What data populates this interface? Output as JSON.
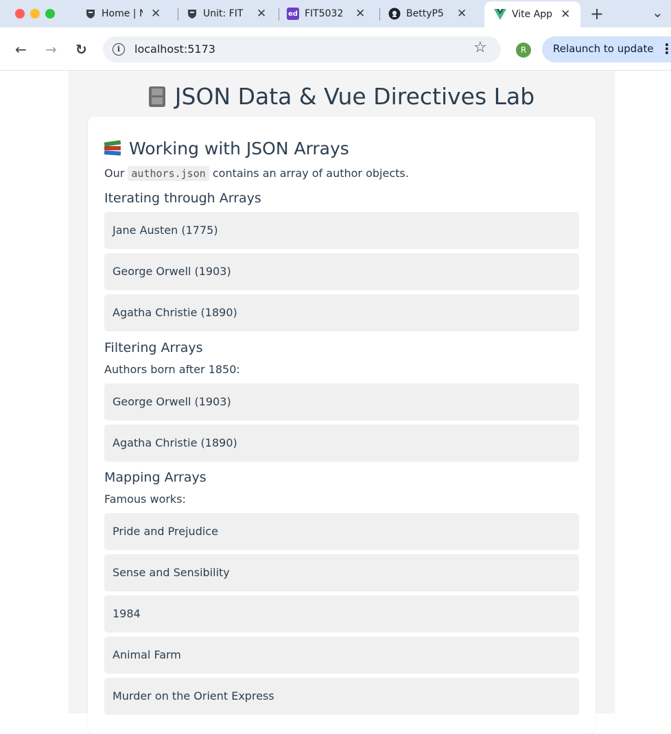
{
  "browser": {
    "tabs": [
      {
        "label": "Home | N",
        "icon": "university-crest-icon"
      },
      {
        "label": "Unit: FIT",
        "icon": "university-crest-icon"
      },
      {
        "label": "FIT5032",
        "icon": "ed-icon",
        "icon_text": "ed"
      },
      {
        "label": "BettyP5",
        "icon": "github-icon"
      },
      {
        "label": "Vite App",
        "icon": "vue-icon",
        "active": true
      }
    ],
    "new_tab": "+",
    "tab_menu": "⌄",
    "url": "localhost:5173",
    "profile_initial": "R",
    "relaunch_label": "Relaunch to update",
    "colors": {
      "accent": "#d3e3fd",
      "tabbar": "#dce5f4",
      "profile": "#5f9f4c",
      "vue_green": "#41b883"
    }
  },
  "page": {
    "title": "JSON Data & Vue Directives Lab",
    "section": {
      "heading": "Working with JSON Arrays",
      "intro_before": "Our",
      "intro_code": "authors.json",
      "intro_after": "contains an array of author objects.",
      "iterating": {
        "heading": "Iterating through Arrays",
        "items": [
          "Jane Austen (1775)",
          "George Orwell (1903)",
          "Agatha Christie (1890)"
        ]
      },
      "filtering": {
        "heading": "Filtering Arrays",
        "caption": "Authors born after 1850:",
        "items": [
          "George Orwell (1903)",
          "Agatha Christie (1890)"
        ]
      },
      "mapping": {
        "heading": "Mapping Arrays",
        "caption": "Famous works:",
        "items": [
          "Pride and Prejudice",
          "Sense and Sensibility",
          "1984",
          "Animal Farm",
          "Murder on the Orient Express"
        ]
      }
    }
  }
}
